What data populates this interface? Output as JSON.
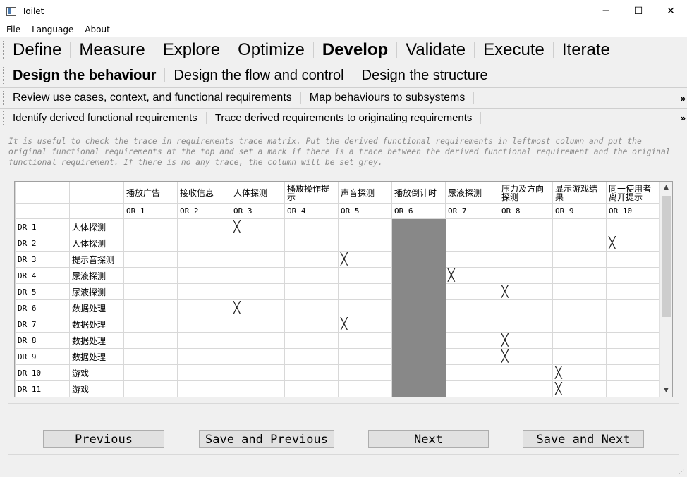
{
  "window": {
    "title": "Toilet",
    "minimize": "─",
    "maximize": "☐",
    "close": "✕"
  },
  "menu": [
    "File",
    "Language",
    "About"
  ],
  "phases": {
    "items": [
      "Define",
      "Measure",
      "Explore",
      "Optimize",
      "Develop",
      "Validate",
      "Execute",
      "Iterate"
    ],
    "active": "Develop"
  },
  "steps": {
    "items": [
      "Design the behaviour",
      "Design the flow and control",
      "Design the structure"
    ],
    "active": "Design the behaviour"
  },
  "subtasks": {
    "items": [
      "Review use cases, context, and functional requirements",
      "Map behaviours to subsystems"
    ],
    "more": "»"
  },
  "subsubtasks": {
    "items": [
      "Identify derived functional requirements",
      "Trace derived requirements to originating requirements"
    ],
    "more": "»"
  },
  "hint": "It is useful to check the trace in requirements trace matrix. Put the derived functional requirements in leftmost column and put the original functional requirements at the top and set a mark if there is a trace between the derived functional requirement and the original functional requirement. If there is no any trace, the column will be set grey.",
  "matrix": {
    "or_names": [
      "播放广告",
      "接收信息",
      "人体探测",
      "播放操作提示",
      "声音探测",
      "播放倒计时",
      "尿液探测",
      "压力及方向探测",
      "显示游戏结果",
      "同一使用者离开提示"
    ],
    "or_ids": [
      "OR 1",
      "OR 2",
      "OR 3",
      "OR 4",
      "OR 5",
      "OR 6",
      "OR 7",
      "OR 8",
      "OR 9",
      "OR 10"
    ],
    "grey_columns": [
      6
    ],
    "mark": "╳",
    "rows": [
      {
        "id": "DR 1",
        "name": "人体探测",
        "marks": [
          3
        ]
      },
      {
        "id": "DR 2",
        "name": "人体探测",
        "marks": [
          10
        ]
      },
      {
        "id": "DR 3",
        "name": "提示音探测",
        "marks": [
          5
        ]
      },
      {
        "id": "DR 4",
        "name": "尿液探测",
        "marks": [
          7
        ]
      },
      {
        "id": "DR 5",
        "name": "尿液探测",
        "marks": [
          8
        ]
      },
      {
        "id": "DR 6",
        "name": "数据处理",
        "marks": [
          3
        ]
      },
      {
        "id": "DR 7",
        "name": "数据处理",
        "marks": [
          5
        ]
      },
      {
        "id": "DR 8",
        "name": "数据处理",
        "marks": [
          8
        ]
      },
      {
        "id": "DR 9",
        "name": "数据处理",
        "marks": [
          8
        ]
      },
      {
        "id": "DR 10",
        "name": "游戏",
        "marks": [
          9
        ]
      },
      {
        "id": "DR 11",
        "name": "游戏",
        "marks": [
          9
        ]
      }
    ]
  },
  "buttons": {
    "previous": "Previous",
    "save_previous": "Save and Previous",
    "next": "Next",
    "save_next": "Save and Next"
  }
}
